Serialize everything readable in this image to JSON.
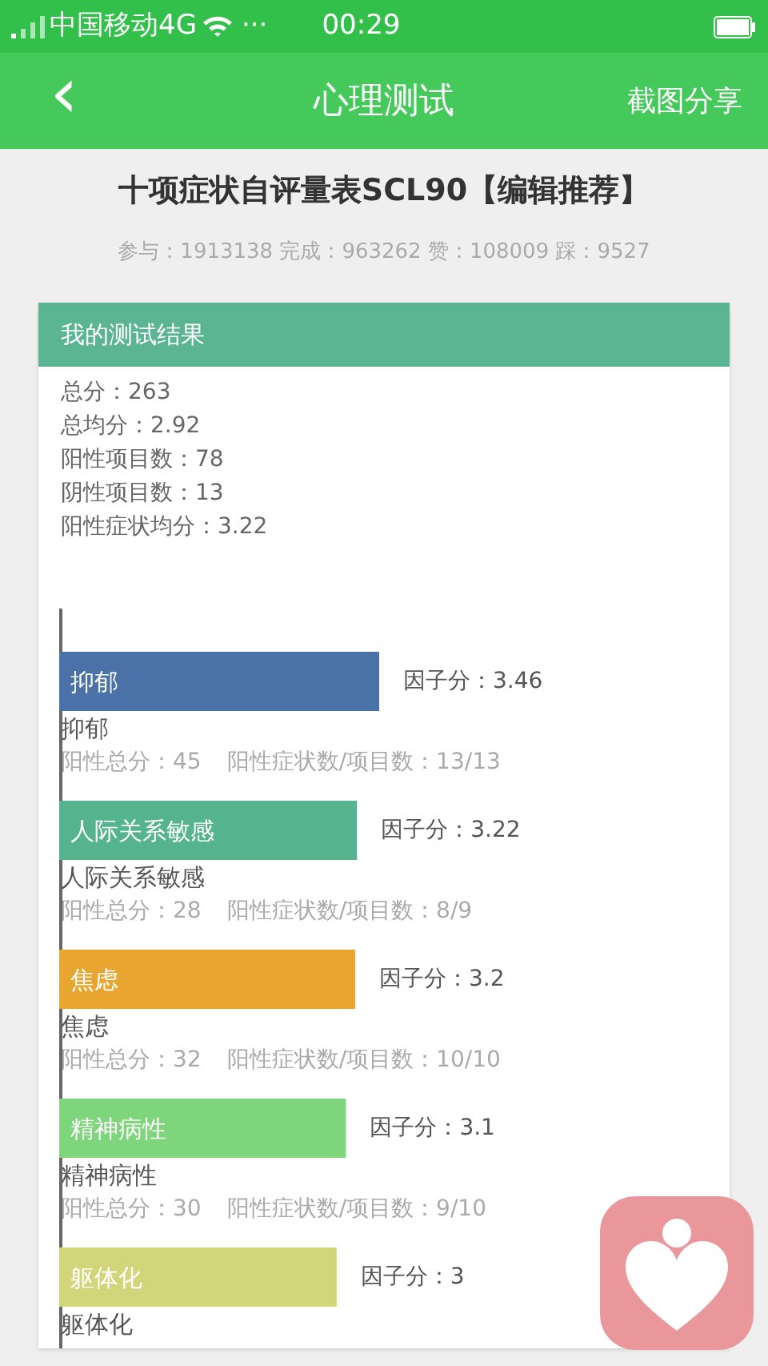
{
  "status_bar": {
    "carrier": "中国移动4G",
    "dots": "···",
    "time": "00:29"
  },
  "nav": {
    "back": "‹",
    "title": "心理测试",
    "action": "截图分享"
  },
  "test": {
    "title": "十项症状自评量表SCL90【编辑推荐】",
    "stats": "参与：1913138 完成：963262 赞：108009 踩：9527"
  },
  "result": {
    "header": "我的测试结果",
    "summary": [
      "总分：263",
      "总均分：2.92",
      "阳性项目数：78",
      "阴性项目数：13",
      "阳性症状均分：3.22"
    ],
    "chart_data": {
      "type": "bar",
      "orientation": "horizontal",
      "categories": [
        "抑郁",
        "人际关系敏感",
        "焦虑",
        "精神病性",
        "躯体化"
      ],
      "values": [
        3.46,
        3.22,
        3.2,
        3.1,
        3
      ],
      "value_labels": [
        "因子分：3.46",
        "因子分：3.22",
        "因子分：3.2",
        "因子分：3.1",
        "因子分：3"
      ]
    },
    "factors": [
      {
        "color": "#4a72a8",
        "caption": "抑郁",
        "details": [
          "阳性总分：45",
          "阳性症状数/项目数：13/13"
        ]
      },
      {
        "color": "#55b48e",
        "caption": "人际关系敏感",
        "details": [
          "阳性总分：28",
          "阳性症状数/项目数：8/9"
        ]
      },
      {
        "color": "#e8a631",
        "caption": "焦虑",
        "details": [
          "阳性总分：32",
          "阳性症状数/项目数：10/10"
        ]
      },
      {
        "color": "#7ed57b",
        "caption": "精神病性",
        "details": [
          "阳性总分：30",
          "阳性症状数/项目数：9/10"
        ]
      },
      {
        "color": "#d2d57a",
        "caption": "躯体化"
      }
    ]
  }
}
